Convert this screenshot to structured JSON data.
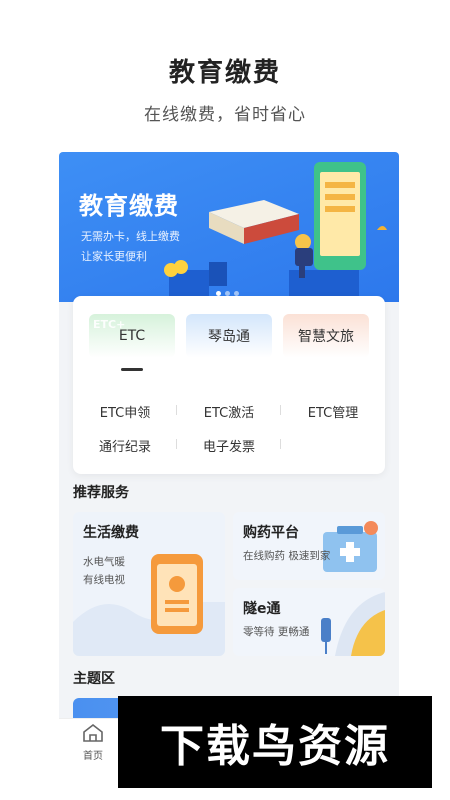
{
  "promo": {
    "title": "教育缴费",
    "subtitle": "在线缴费，省时省心"
  },
  "banner": {
    "title": "教育缴费",
    "line1": "无需办卡，线上缴费",
    "line2": "让家长更便利",
    "dots": 3,
    "active_dot": 0,
    "color": "#2d78ec"
  },
  "tabs": [
    {
      "label": "ETC",
      "watermark": "ETC+",
      "active": true
    },
    {
      "label": "琴岛通",
      "active": false
    },
    {
      "label": "智慧文旅",
      "active": false
    }
  ],
  "services_grid": {
    "row1": [
      "ETC申领",
      "ETC激活",
      "ETC管理"
    ],
    "row2": [
      "通行纪录",
      "电子发票",
      ""
    ]
  },
  "recommend": {
    "section_title": "推荐服务",
    "life": {
      "title": "生活缴费",
      "desc1": "水电气暖",
      "desc2": "有线电视"
    },
    "pharmacy": {
      "title": "购药平台",
      "desc": "在线购药 极速到家"
    },
    "tunnel": {
      "title": "隧e通",
      "desc": "零等待 更畅通"
    }
  },
  "theme": {
    "section_title": "主题区"
  },
  "tabbar": {
    "home_label": "首页"
  },
  "watermark": {
    "text": "下载鸟资源"
  }
}
